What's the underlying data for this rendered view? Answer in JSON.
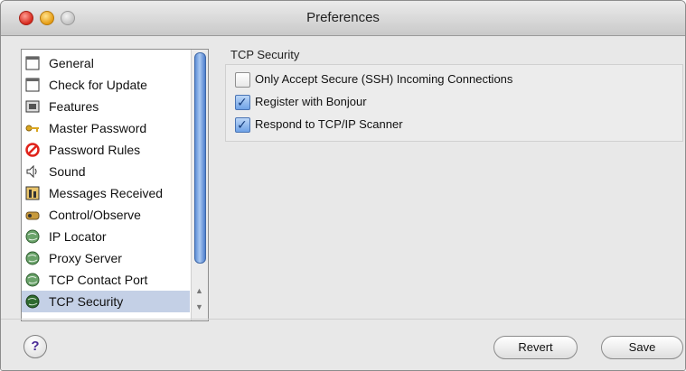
{
  "window": {
    "title": "Preferences"
  },
  "sidebar": {
    "items": [
      {
        "label": "General",
        "icon": "window-icon"
      },
      {
        "label": "Check for Update",
        "icon": "window-icon"
      },
      {
        "label": "Features",
        "icon": "features-icon"
      },
      {
        "label": "Master Password",
        "icon": "key-icon"
      },
      {
        "label": "Password Rules",
        "icon": "prohibited-icon"
      },
      {
        "label": "Sound",
        "icon": "speaker-icon"
      },
      {
        "label": "Messages Received",
        "icon": "messages-icon"
      },
      {
        "label": "Control/Observe",
        "icon": "control-icon"
      },
      {
        "label": "IP Locator",
        "icon": "globe-icon"
      },
      {
        "label": "Proxy Server",
        "icon": "globe-icon"
      },
      {
        "label": "TCP Contact Port",
        "icon": "globe-icon"
      },
      {
        "label": "TCP Security",
        "icon": "globe-icon"
      }
    ],
    "selected": "TCP Security"
  },
  "tcp_security": {
    "group_title": "TCP Security",
    "options": [
      {
        "label": "Only Accept Secure (SSH) Incoming Connections",
        "checked": false
      },
      {
        "label": "Register with Bonjour",
        "checked": true
      },
      {
        "label": "Respond to TCP/IP Scanner",
        "checked": true
      }
    ]
  },
  "footer": {
    "help_label": "?",
    "revert_label": "Revert",
    "save_label": "Save"
  },
  "colors": {
    "selection": "#c4d0e6",
    "checkbox_on": "#6fa2e6",
    "help_glyph": "#4a2a96"
  }
}
